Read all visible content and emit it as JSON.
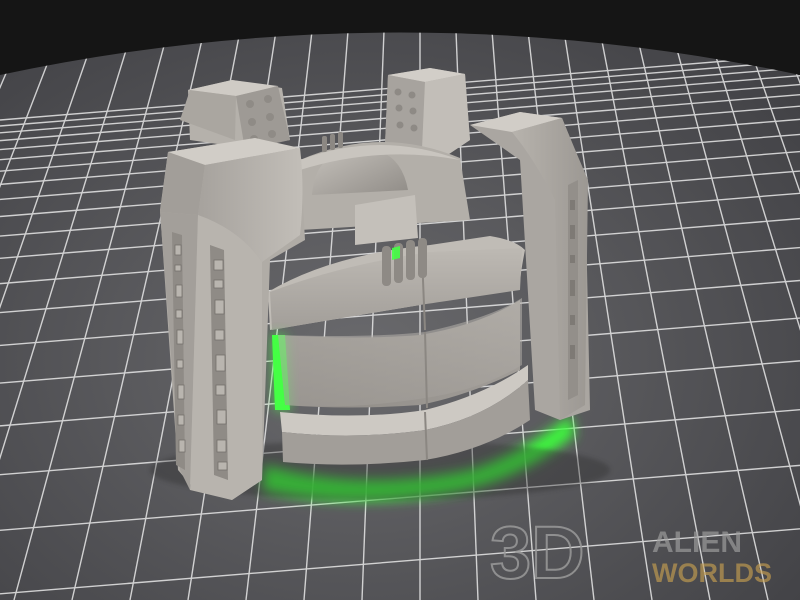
{
  "scene": {
    "subject": "sci-fi-terrain-bunker",
    "glow_color": "#39ff3a",
    "model_color": "#a9a5a0",
    "grid_color": "#ffffff",
    "floor_color": "#55555a",
    "sky_color": "#141414"
  },
  "watermark": {
    "logo_mark": "3D",
    "line1": "ALIEN",
    "line2": "WORLDS",
    "accent_color": "#c8a050"
  }
}
